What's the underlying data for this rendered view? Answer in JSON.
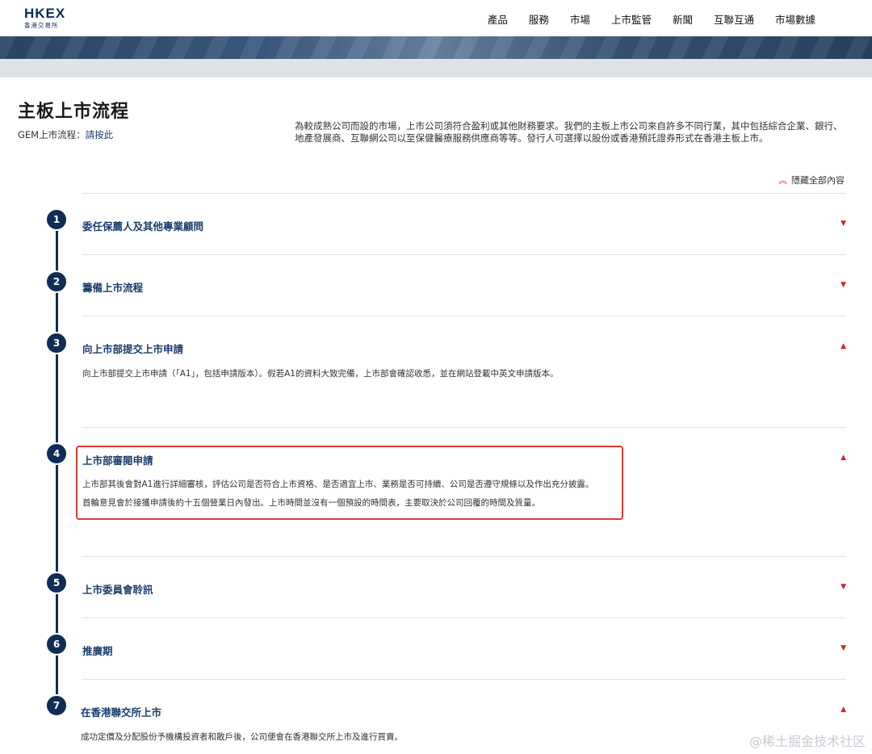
{
  "header": {
    "logo_main": "HKEX",
    "logo_sub": "香港交易所",
    "nav": [
      "產品",
      "服務",
      "市場",
      "上市監管",
      "新聞",
      "互聯互通",
      "市場數據"
    ]
  },
  "page": {
    "title": "主板上市流程",
    "gem_prefix": "GEM上市流程：",
    "gem_link": "請按此",
    "intro": "為較成熟公司而設的市場，上市公司須符合盈利或其他財務要求。我們的主板上市公司來自許多不同行業，其中包括綜合企業、銀行、地產發展商、互聯網公司以至保健醫療服務供應商等等。發行人可選擇以股份或香港預託證券形式在香港主板上市。",
    "collapse_all": "隱藏全部內容"
  },
  "steps": [
    {
      "num": "1",
      "title": "委任保薦人及其他專業顧問",
      "expanded": false
    },
    {
      "num": "2",
      "title": "籌備上市流程",
      "expanded": false
    },
    {
      "num": "3",
      "title": "向上市部提交上市申請",
      "expanded": true,
      "body": [
        "向上市部提交上市申請（「A1」，包括申請版本）。假若A1的資料大致完備，上市部會確認收悉，並在網站登載中英文申請版本。"
      ]
    },
    {
      "num": "4",
      "title": "上市部審閱申請",
      "expanded": true,
      "body": [
        "上市部其後會對A1進行詳細審核，評估公司是否符合上市資格、是否適宜上市、業務是否可持續、公司是否遵守規條以及作出充分披露。",
        "首輪意見會於接獲申請後約十五個營業日內發出。上市時間並沒有一個預設的時間表，主要取決於公司回覆的時間及質量。"
      ]
    },
    {
      "num": "5",
      "title": "上市委員會聆訊",
      "expanded": false
    },
    {
      "num": "6",
      "title": "推廣期",
      "expanded": false
    },
    {
      "num": "7",
      "title": "在香港聯交所上市",
      "expanded": true,
      "body": [
        "成功定價及分配股份予機構投資者和散戶後，公司便會在香港聯交所上市及進行買賣。"
      ]
    }
  ],
  "watermark": "@稀土掘金技术社区",
  "colors": {
    "navy": "#0f2d55",
    "link": "#1a3c6e",
    "accent_red": "#d2232a",
    "highlight_border": "#e0392f"
  }
}
